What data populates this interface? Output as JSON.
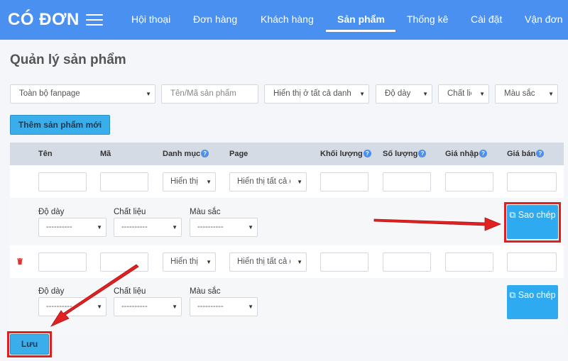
{
  "brand": {
    "logo": "CÓ ĐƠN"
  },
  "nav": {
    "items": [
      {
        "label": "Hội thoại",
        "active": false
      },
      {
        "label": "Đơn hàng",
        "active": false
      },
      {
        "label": "Khách hàng",
        "active": false
      },
      {
        "label": "Sản phẩm",
        "active": true
      },
      {
        "label": "Thống kê",
        "active": false
      },
      {
        "label": "Cài đặt",
        "active": false
      },
      {
        "label": "Vận đơn",
        "active": false
      }
    ]
  },
  "page": {
    "title": "Quản lý sản phẩm"
  },
  "filters": {
    "fanpage": "Toàn bộ fanpage",
    "search_placeholder": "Tên/Mã sản phẩm",
    "display": "Hiển thị ở tất cả danh mục",
    "thickness": "Độ dày",
    "material": "Chất liệu",
    "color": "Màu sắc"
  },
  "actions": {
    "add_product": "Thêm sản phẩm mới",
    "save": "Lưu"
  },
  "table": {
    "headers": {
      "name": "Tên",
      "code": "Mã",
      "category": "Danh mục",
      "page": "Page",
      "weight": "Khối lượng",
      "quantity": "Số lượng",
      "cost_price": "Giá nhập",
      "sale_price": "Giá bán"
    },
    "help_glyph": "?",
    "rows": [
      {
        "category": "Hiển thị",
        "page": "Hiển thị tất cả danh mục",
        "attributes": {
          "thickness_label": "Độ dày",
          "thickness_value": "----------",
          "material_label": "Chất liệu",
          "material_value": "----------",
          "color_label": "Màu sắc",
          "color_value": "----------"
        },
        "copy_label": "Sao chép"
      },
      {
        "category": "Hiển thị",
        "page": "Hiển thị tất cả danh mục",
        "attributes": {
          "thickness_label": "Độ dày",
          "thickness_value": "----------",
          "material_label": "Chất liệu",
          "material_value": "----------",
          "color_label": "Màu sắc",
          "color_value": "----------"
        },
        "copy_label": "Sao chép"
      }
    ]
  },
  "colors": {
    "nav_bg": "#4a90f0",
    "accent": "#2daaf0",
    "highlight": "#e02020"
  },
  "icons": [
    "menu-icon",
    "chevron-down-icon",
    "help-icon",
    "copy-icon",
    "trash-icon",
    "arrow-pointer"
  ]
}
